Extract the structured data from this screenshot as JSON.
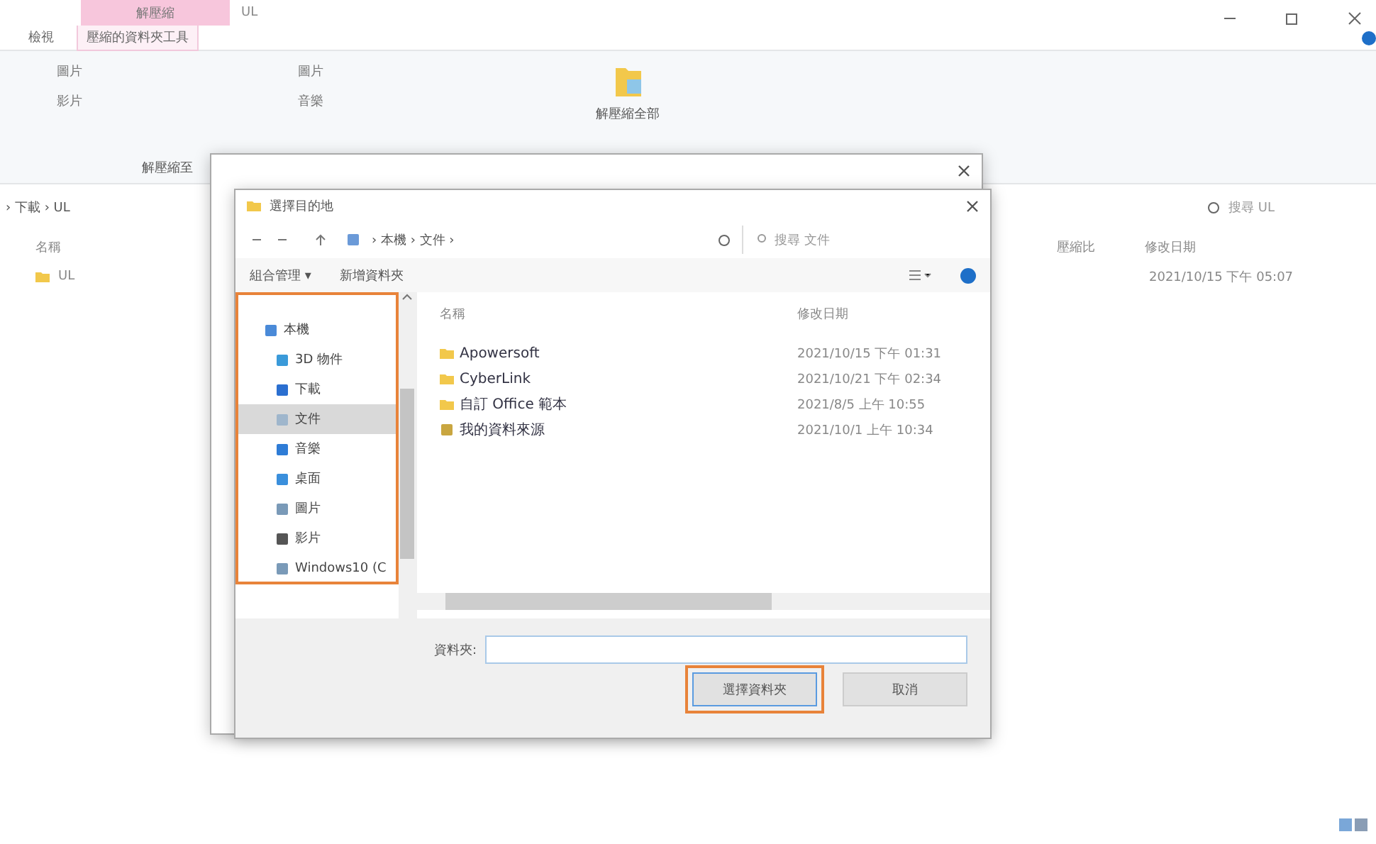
{
  "window": {
    "title": "UL",
    "context_tab": "解壓縮"
  },
  "ribbon_tabs": [
    {
      "label": "檢視",
      "selected": false
    },
    {
      "label": "壓縮的資料夾工具",
      "selected": true
    }
  ],
  "ribbon": {
    "columns": [
      [
        "圖片",
        "影片"
      ],
      [
        "圖片",
        "音樂"
      ]
    ],
    "extract_all": "解壓縮全部",
    "group_label": "解壓縮至"
  },
  "address": {
    "path": "› 下載 › UL",
    "search_placeholder": "搜尋 UL"
  },
  "list": {
    "columns": [
      "名稱",
      "壓縮比",
      "修改日期"
    ],
    "rows": [
      {
        "name": "UL",
        "date": "2021/10/15 下午 05:07"
      }
    ]
  },
  "dialog": {
    "title": "選擇目的地",
    "path": "› 本機 › 文件 ›",
    "search_placeholder": "搜尋 文件",
    "toolbar": [
      "組合管理 ▾",
      "新增資料夾"
    ],
    "nav": [
      {
        "label": "本機",
        "selected": false,
        "children": [
          {
            "label": "3D 物件",
            "selected": false
          },
          {
            "label": "下載",
            "selected": false
          },
          {
            "label": "文件",
            "selected": true
          },
          {
            "label": "音樂",
            "selected": false
          },
          {
            "label": "桌面",
            "selected": false
          },
          {
            "label": "圖片",
            "selected": false
          },
          {
            "label": "影片",
            "selected": false
          },
          {
            "label": "Windows10 (C",
            "selected": false
          }
        ]
      }
    ],
    "columns": [
      "名稱",
      "修改日期"
    ],
    "files": [
      {
        "name": "Apowersoft",
        "date": "2021/10/15 下午 01:31",
        "kind": "shortcut"
      },
      {
        "name": "CyberLink",
        "date": "2021/10/21 下午 02:34",
        "kind": "shortcut"
      },
      {
        "name": "自訂 Office 範本",
        "date": "2021/8/5 上午 10:55",
        "kind": "shortcut"
      },
      {
        "name": "我的資料來源",
        "date": "2021/10/1 上午 10:34",
        "kind": "special"
      }
    ],
    "folder_label": "資料夾:",
    "buttons": [
      {
        "label": "選擇資料夾",
        "highlighted": true
      },
      {
        "label": "取消",
        "highlighted": false
      }
    ],
    "nav_highlighted": true
  }
}
